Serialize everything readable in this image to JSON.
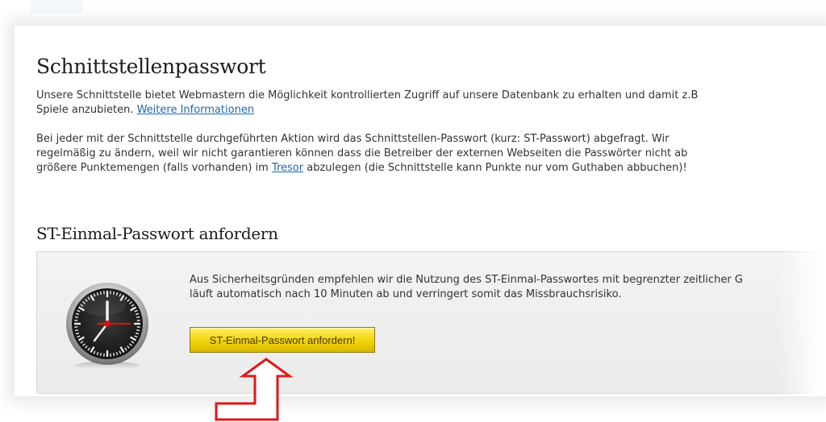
{
  "page": {
    "title": "Schnittstellenpasswort",
    "intro_line1": "Unsere Schnittstelle bietet Webmastern die Möglichkeit kontrollierten Zugriff auf unsere Datenbank zu erhalten und damit z.B",
    "intro_line2_pre": "Spiele anzubieten. ",
    "more_info_link": "Weitere Informationen",
    "para2_line1": "Bei jeder mit der Schnittstelle durchgeführten Aktion wird das Schnittstellen-Passwort (kurz: ST-Passwort) abgefragt. Wir",
    "para2_line2": "regelmäßig zu ändern, weil wir nicht garantieren können dass die Betreiber der externen Webseiten die Passwörter nicht ab",
    "para2_line3_pre": "größere Punktemengen (falls vorhanden) im ",
    "tresor_link": "Tresor",
    "para2_line3_post": " abzulegen (die Schnittstelle kann Punkte nur vom Guthaben abbuchen)!"
  },
  "one_time": {
    "heading": "ST-Einmal-Passwort anfordern",
    "text_line1": "Aus Sicherheitsgründen empfehlen wir die Nutzung des ST-Einmal-Passwortes mit begrenzter zeitlicher G",
    "text_line2": "läuft automatisch nach 10 Minuten ab und verringert somit das Missbrauchsrisiko.",
    "button_label": "ST-Einmal-Passwort anfordern!",
    "clock_icon": "clock-icon"
  },
  "colors": {
    "link": "#1f66b0",
    "button": "#f2d60c",
    "arrow": "#e01818"
  }
}
